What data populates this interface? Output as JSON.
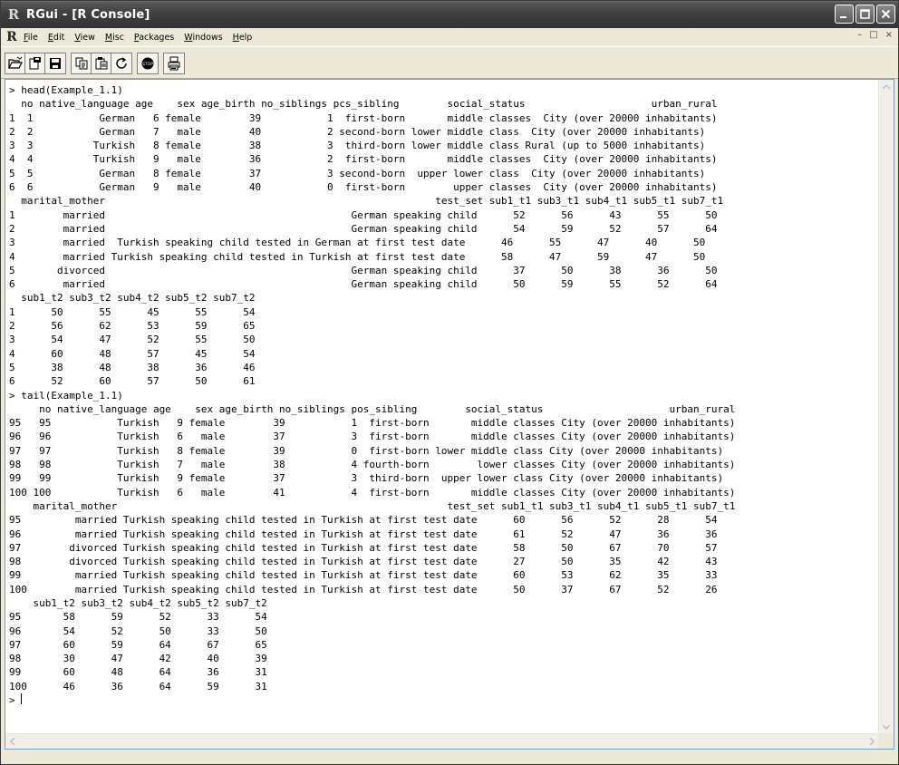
{
  "window": {
    "title": "RGui - [R Console]",
    "controls": [
      "minimize-icon",
      "maximize-icon",
      "close-icon"
    ]
  },
  "menubar": {
    "items": [
      {
        "first": "F",
        "rest": "ile"
      },
      {
        "first": "E",
        "rest": "dit"
      },
      {
        "first": "V",
        "rest": "iew"
      },
      {
        "first": "M",
        "rest": "isc"
      },
      {
        "first": "P",
        "rest": "ackages"
      },
      {
        "first": "W",
        "rest": "indows"
      },
      {
        "first": "H",
        "rest": "elp"
      }
    ],
    "mdi_controls": [
      "–",
      "□",
      "×"
    ]
  },
  "toolbar": {
    "icons": [
      "open-script-icon",
      "load-workspace-icon",
      "save-workspace-icon",
      "copy-icon",
      "paste-icon",
      "copy-paste-icon",
      "stop-icon",
      "print-icon"
    ]
  },
  "console": {
    "lines": [
      "> head(Example_1.1)",
      "  no native_language age    sex age_birth no_siblings pcs_sibling        social_status                     urban_rural",
      "1  1           German   6 female        39           1  first-born       middle classes  City (over 20000 inhabitants)",
      "2  2           German   7   male        40           2 second-born lower middle class  City (over 20000 inhabitants)",
      "3  3          Turkish   8 female        38           3  third-born lower middle class Rural (up to 5000 inhabitants)",
      "4  4          Turkish   9   male        36           2  first-born       middle classes  City (over 20000 inhabitants)",
      "5  5           German   8 female        37           3 second-born  upper lower class  City (over 20000 inhabitants)",
      "6  6           German   9   male        40           0  first-born        upper classes  City (over 20000 inhabitants)",
      "  marital_mother                                                       test_set sub1_t1 sub3_t1 sub4_t1 sub5_t1 sub7_t1",
      "1        married                                         German speaking child      52      56      43      55      50",
      "2        married                                         German speaking child      54      59      52      57      64",
      "3        married  Turkish speaking child tested in German at first test date      46      55      47      40      50",
      "4        married Turkish speaking child tested in Turkish at first test date      58      47      59      47      50",
      "5       divorced                                         German speaking child      37      50      38      36      50",
      "6        married                                         German speaking child      50      59      55      52      64",
      "  sub1_t2 sub3_t2 sub4_t2 sub5_t2 sub7_t2",
      "1      50      55      45      55      54",
      "2      56      62      53      59      65",
      "3      54      47      52      55      50",
      "4      60      48      57      45      54",
      "5      38      48      38      36      46",
      "6      52      60      57      50      61",
      "> tail(Example_1.1)",
      "     no native_language age    sex age_birth no_siblings pos_sibling        social_status                     urban_rural",
      "95   95           Turkish   9 female        39           1  first-born       middle classes City (over 20000 inhabitants)",
      "96   96           Turkish   6   male        37           3  first-born       middle classes City (over 20000 inhabitants)",
      "97   97           Turkish   8 female        39           0  first-born lower middle class City (over 20000 inhabitants)",
      "98   98           Turkish   7   male        38           4 fourth-born        lower classes City (over 20000 inhabitants)",
      "99   99           Turkish   9 female        37           3  third-born  upper lower class City (over 20000 inhabitants)",
      "100 100           Turkish   6   male        41           4  first-born       middle classes City (over 20000 inhabitants)",
      "    marital_mother                                                       test_set sub1_t1 sub3_t1 sub4_t1 sub5_t1 sub7_t1",
      "95         married Turkish speaking child tested in Turkish at first test date      60      56      52      28      54",
      "96         married Turkish speaking child tested in Turkish at first test date      61      52      47      36      36",
      "97        divorced Turkish speaking child tested in Turkish at first test date      58      50      67      70      57",
      "98        divorced Turkish speaking child tested in Turkish at first test date      27      50      35      42      43",
      "99         married Turkish speaking child tested in Turkish at first test date      60      53      62      35      33",
      "100        married Turkish speaking child tested in Turkish at first test date      50      37      67      52      26",
      "    sub1_t2 sub3_t2 sub4_t2 sub5_t2 sub7_t2",
      "95       58      59      52      33      54",
      "96       54      52      50      33      50",
      "97       60      59      64      67      65",
      "98       30      47      42      40      39",
      "99       60      48      64      36      31",
      "100      46      36      64      59      31"
    ],
    "prompt": "> "
  }
}
